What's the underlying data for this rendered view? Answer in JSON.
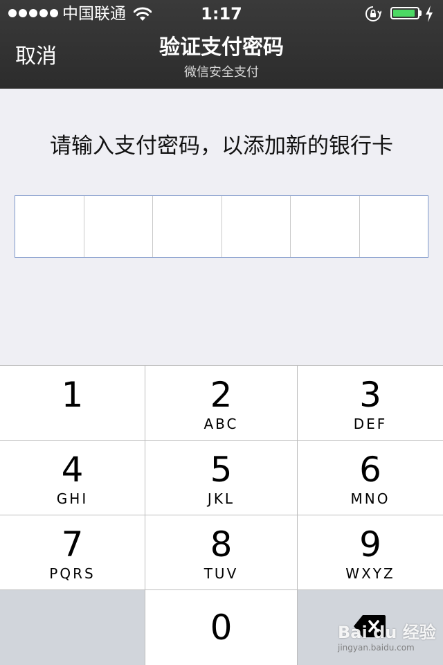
{
  "status_bar": {
    "carrier": "中国联通",
    "time": "1:17",
    "signal_bars": 5,
    "battery_level": 0.9,
    "battery_color": "#4cd964",
    "icons": [
      "wifi-icon",
      "rotation-lock-icon",
      "battery-icon",
      "charging-bolt-icon"
    ]
  },
  "nav": {
    "cancel_label": "取消",
    "title": "验证支付密码",
    "subtitle": "微信安全支付"
  },
  "content": {
    "prompt": "请输入支付密码，以添加新的银行卡",
    "pin_length": 6,
    "pin_border_color": "#7b95c9"
  },
  "keypad": {
    "keys": [
      {
        "digit": "1",
        "letters": ""
      },
      {
        "digit": "2",
        "letters": "ABC"
      },
      {
        "digit": "3",
        "letters": "DEF"
      },
      {
        "digit": "4",
        "letters": "GHI"
      },
      {
        "digit": "5",
        "letters": "JKL"
      },
      {
        "digit": "6",
        "letters": "MNO"
      },
      {
        "digit": "7",
        "letters": "PQRS"
      },
      {
        "digit": "8",
        "letters": "TUV"
      },
      {
        "digit": "9",
        "letters": "WXYZ"
      },
      {
        "digit": "0",
        "letters": ""
      }
    ],
    "delete_icon": "backspace-icon"
  },
  "watermark": {
    "main": "Bai du 经验",
    "url": "jingyan.baidu.com"
  }
}
